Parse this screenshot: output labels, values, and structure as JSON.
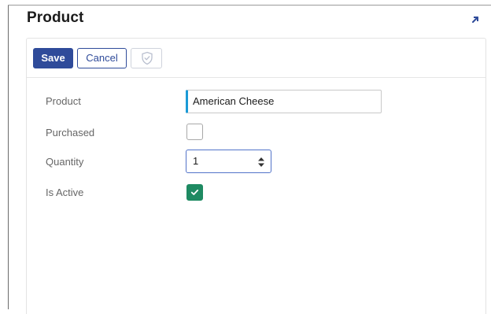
{
  "panel": {
    "title": "Product"
  },
  "toolbar": {
    "save_label": "Save",
    "cancel_label": "Cancel"
  },
  "form": {
    "product": {
      "label": "Product",
      "value": "American Cheese"
    },
    "purchased": {
      "label": "Purchased",
      "checked": false
    },
    "quantity": {
      "label": "Quantity",
      "value": "1"
    },
    "is_active": {
      "label": "Is Active",
      "checked": true
    }
  },
  "icons": {
    "expand": "expand-arrow-icon",
    "shield": "shield-check-icon",
    "checkmark": "checkmark-icon",
    "spinner": "spinner-arrows-icon"
  },
  "colors": {
    "primary": "#2f4b9a",
    "focus_accent": "#1a9ad6",
    "checked": "#1e8a62",
    "label": "#666666"
  }
}
